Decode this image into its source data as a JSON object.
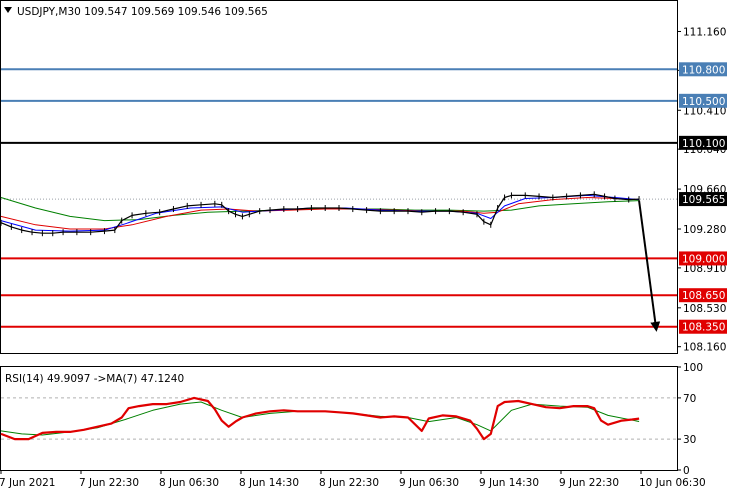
{
  "colors": {
    "resistance": "#4a7fb5",
    "pivot": "#000000",
    "support": "#e00000",
    "price_label_bg": "#000000",
    "ma_fast": "#0000ff",
    "ma_mid": "#e00000",
    "ma_slow": "#008000",
    "rsi_line": "#e00000",
    "rsi_ma": "#008000"
  },
  "chart_data": [
    {
      "type": "candlestick",
      "title": "USDJPY,M30  109.547 109.569 109.546 109.565",
      "symbol": "USDJPY,M30",
      "ohlc": {
        "open": "109.547",
        "high": "109.569",
        "low": "109.546",
        "close": "109.565"
      },
      "ylim": [
        108.1,
        111.45
      ],
      "y_ticks": [
        "111.160",
        "110.790",
        "110.410",
        "110.040",
        "109.660",
        "109.280",
        "108.910",
        "108.530",
        "108.160"
      ],
      "x_ticks": [
        "7 Jun 2021",
        "7 Jun 22:30",
        "8 Jun 06:30",
        "8 Jun 14:30",
        "8 Jun 22:30",
        "9 Jun 06:30",
        "9 Jun 14:30",
        "9 Jun 22:30",
        "10 Jun 06:30"
      ],
      "current_price": {
        "value": 109.565,
        "label": "109.565"
      },
      "levels": [
        {
          "value": 110.8,
          "label": "110.800",
          "role": "resistance"
        },
        {
          "value": 110.5,
          "label": "110.500",
          "role": "resistance"
        },
        {
          "value": 110.1,
          "label": "110.100",
          "role": "pivot"
        },
        {
          "value": 109.0,
          "label": "109.000",
          "role": "support"
        },
        {
          "value": 108.65,
          "label": "108.650",
          "role": "support"
        },
        {
          "value": 108.35,
          "label": "108.350",
          "role": "support"
        }
      ],
      "forecast_arrow": {
        "from": [
          185,
          109.55
        ],
        "to": [
          190,
          108.32
        ]
      },
      "price_series": [
        [
          0,
          109.34
        ],
        [
          3,
          109.3
        ],
        [
          6,
          109.27
        ],
        [
          9,
          109.25
        ],
        [
          12,
          109.24
        ],
        [
          15,
          109.24
        ],
        [
          18,
          109.25
        ],
        [
          22,
          109.25
        ],
        [
          26,
          109.25
        ],
        [
          30,
          109.26
        ],
        [
          33,
          109.27
        ],
        [
          35,
          109.36
        ],
        [
          38,
          109.41
        ],
        [
          42,
          109.43
        ],
        [
          46,
          109.44
        ],
        [
          50,
          109.47
        ],
        [
          54,
          109.5
        ],
        [
          58,
          109.51
        ],
        [
          62,
          109.52
        ],
        [
          64,
          109.51
        ],
        [
          66,
          109.45
        ],
        [
          68,
          109.42
        ],
        [
          70,
          109.4
        ],
        [
          72,
          109.42
        ],
        [
          75,
          109.45
        ],
        [
          78,
          109.46
        ],
        [
          82,
          109.47
        ],
        [
          86,
          109.47
        ],
        [
          90,
          109.48
        ],
        [
          94,
          109.48
        ],
        [
          98,
          109.48
        ],
        [
          102,
          109.47
        ],
        [
          106,
          109.46
        ],
        [
          110,
          109.45
        ],
        [
          114,
          109.45
        ],
        [
          118,
          109.45
        ],
        [
          122,
          109.44
        ],
        [
          126,
          109.45
        ],
        [
          130,
          109.45
        ],
        [
          134,
          109.44
        ],
        [
          138,
          109.42
        ],
        [
          140,
          109.35
        ],
        [
          142,
          109.32
        ],
        [
          144,
          109.48
        ],
        [
          146,
          109.58
        ],
        [
          148,
          109.6
        ],
        [
          152,
          109.6
        ],
        [
          156,
          109.59
        ],
        [
          160,
          109.58
        ],
        [
          164,
          109.59
        ],
        [
          168,
          109.6
        ],
        [
          172,
          109.61
        ],
        [
          175,
          109.59
        ],
        [
          178,
          109.57
        ],
        [
          182,
          109.56
        ],
        [
          185,
          109.565
        ]
      ],
      "ma_fast_series": [
        [
          0,
          109.36
        ],
        [
          10,
          109.27
        ],
        [
          20,
          109.26
        ],
        [
          30,
          109.27
        ],
        [
          36,
          109.33
        ],
        [
          45,
          109.43
        ],
        [
          55,
          109.48
        ],
        [
          64,
          109.49
        ],
        [
          70,
          109.44
        ],
        [
          80,
          109.46
        ],
        [
          90,
          109.48
        ],
        [
          100,
          109.48
        ],
        [
          110,
          109.46
        ],
        [
          120,
          109.45
        ],
        [
          130,
          109.45
        ],
        [
          138,
          109.43
        ],
        [
          142,
          109.38
        ],
        [
          146,
          109.5
        ],
        [
          152,
          109.57
        ],
        [
          160,
          109.58
        ],
        [
          170,
          109.6
        ],
        [
          178,
          109.58
        ],
        [
          185,
          109.56
        ]
      ],
      "ma_mid_series": [
        [
          0,
          109.4
        ],
        [
          10,
          109.32
        ],
        [
          20,
          109.28
        ],
        [
          30,
          109.28
        ],
        [
          38,
          109.32
        ],
        [
          48,
          109.4
        ],
        [
          58,
          109.46
        ],
        [
          66,
          109.47
        ],
        [
          74,
          109.45
        ],
        [
          84,
          109.46
        ],
        [
          94,
          109.47
        ],
        [
          104,
          109.47
        ],
        [
          114,
          109.46
        ],
        [
          124,
          109.45
        ],
        [
          134,
          109.45
        ],
        [
          140,
          109.43
        ],
        [
          144,
          109.44
        ],
        [
          150,
          109.52
        ],
        [
          160,
          109.56
        ],
        [
          170,
          109.58
        ],
        [
          178,
          109.57
        ],
        [
          185,
          109.56
        ]
      ],
      "ma_slow_series": [
        [
          0,
          109.58
        ],
        [
          10,
          109.48
        ],
        [
          20,
          109.4
        ],
        [
          30,
          109.36
        ],
        [
          40,
          109.37
        ],
        [
          50,
          109.41
        ],
        [
          60,
          109.44
        ],
        [
          70,
          109.45
        ],
        [
          80,
          109.46
        ],
        [
          90,
          109.47
        ],
        [
          100,
          109.47
        ],
        [
          110,
          109.47
        ],
        [
          120,
          109.46
        ],
        [
          130,
          109.46
        ],
        [
          140,
          109.45
        ],
        [
          148,
          109.46
        ],
        [
          156,
          109.5
        ],
        [
          166,
          109.52
        ],
        [
          176,
          109.54
        ],
        [
          185,
          109.55
        ]
      ]
    },
    {
      "type": "line",
      "title": "RSI(14) 49.9097  ->MA(7) 47.1240",
      "ylim": [
        0,
        100
      ],
      "y_ticks": [
        "100",
        "70",
        "30",
        "0"
      ],
      "levels": [
        70,
        30
      ],
      "series": [
        {
          "name": "RSI(14) 49.9097",
          "values": [
            [
              0,
              35
            ],
            [
              4,
              30
            ],
            [
              8,
              30
            ],
            [
              12,
              36
            ],
            [
              16,
              37
            ],
            [
              20,
              37
            ],
            [
              24,
              39
            ],
            [
              28,
              42
            ],
            [
              32,
              45
            ],
            [
              35,
              51
            ],
            [
              37,
              60
            ],
            [
              40,
              62
            ],
            [
              44,
              64
            ],
            [
              48,
              64
            ],
            [
              52,
              66
            ],
            [
              56,
              70
            ],
            [
              60,
              67
            ],
            [
              62,
              59
            ],
            [
              64,
              48
            ],
            [
              66,
              42
            ],
            [
              68,
              47
            ],
            [
              70,
              51
            ],
            [
              74,
              55
            ],
            [
              78,
              57
            ],
            [
              82,
              58
            ],
            [
              86,
              57
            ],
            [
              90,
              57
            ],
            [
              94,
              57
            ],
            [
              98,
              56
            ],
            [
              102,
              55
            ],
            [
              106,
              53
            ],
            [
              110,
              51
            ],
            [
              114,
              52
            ],
            [
              118,
              51
            ],
            [
              122,
              38
            ],
            [
              124,
              50
            ],
            [
              128,
              53
            ],
            [
              132,
              52
            ],
            [
              136,
              48
            ],
            [
              138,
              40
            ],
            [
              140,
              30
            ],
            [
              142,
              35
            ],
            [
              144,
              62
            ],
            [
              146,
              66
            ],
            [
              150,
              67
            ],
            [
              154,
              64
            ],
            [
              158,
              61
            ],
            [
              162,
              60
            ],
            [
              166,
              62
            ],
            [
              170,
              62
            ],
            [
              172,
              60
            ],
            [
              174,
              48
            ],
            [
              176,
              44
            ],
            [
              180,
              48
            ],
            [
              183,
              49
            ],
            [
              185,
              49.9
            ]
          ]
        },
        {
          "name": "->MA(7) 47.1240",
          "values": [
            [
              0,
              38
            ],
            [
              6,
              35
            ],
            [
              12,
              34
            ],
            [
              20,
              37
            ],
            [
              28,
              41
            ],
            [
              36,
              49
            ],
            [
              44,
              58
            ],
            [
              52,
              64
            ],
            [
              58,
              66
            ],
            [
              64,
              58
            ],
            [
              70,
              51
            ],
            [
              78,
              55
            ],
            [
              86,
              57
            ],
            [
              94,
              57
            ],
            [
              102,
              55
            ],
            [
              110,
              52
            ],
            [
              118,
              51
            ],
            [
              124,
              47
            ],
            [
              132,
              51
            ],
            [
              138,
              44
            ],
            [
              142,
              38
            ],
            [
              148,
              58
            ],
            [
              154,
              64
            ],
            [
              162,
              62
            ],
            [
              170,
              61
            ],
            [
              176,
              53
            ],
            [
              185,
              47.1
            ]
          ]
        }
      ]
    }
  ]
}
